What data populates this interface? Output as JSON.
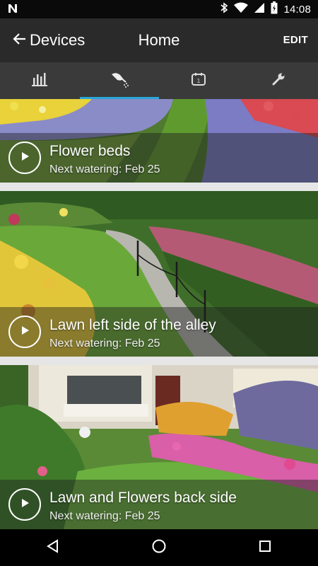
{
  "status_bar": {
    "time": "14:08",
    "icons": [
      "n-logo-icon",
      "bluetooth-icon",
      "wifi-icon",
      "signal-icon",
      "battery-icon"
    ]
  },
  "app_bar": {
    "back_label": "Devices",
    "title": "Home",
    "edit_label": "EDIT",
    "background": "#2a2a2a"
  },
  "tabs": [
    {
      "icon": "bar-chart-icon",
      "active": false
    },
    {
      "icon": "watering-can-icon",
      "active": true
    },
    {
      "icon": "calendar-icon",
      "active": false
    },
    {
      "icon": "wrench-icon",
      "active": false
    }
  ],
  "accent_color": "#2aa6d8",
  "zones": [
    {
      "name": "Flower beds",
      "next_watering": "Next watering: Feb 25"
    },
    {
      "name": "Lawn left side of the alley",
      "next_watering": "Next watering: Feb 25"
    },
    {
      "name": "Lawn and Flowers back side",
      "next_watering": "Next watering: Feb 25"
    }
  ],
  "nav_bar": {
    "buttons": [
      "back-triangle-icon",
      "home-circle-icon",
      "recents-square-icon"
    ]
  }
}
